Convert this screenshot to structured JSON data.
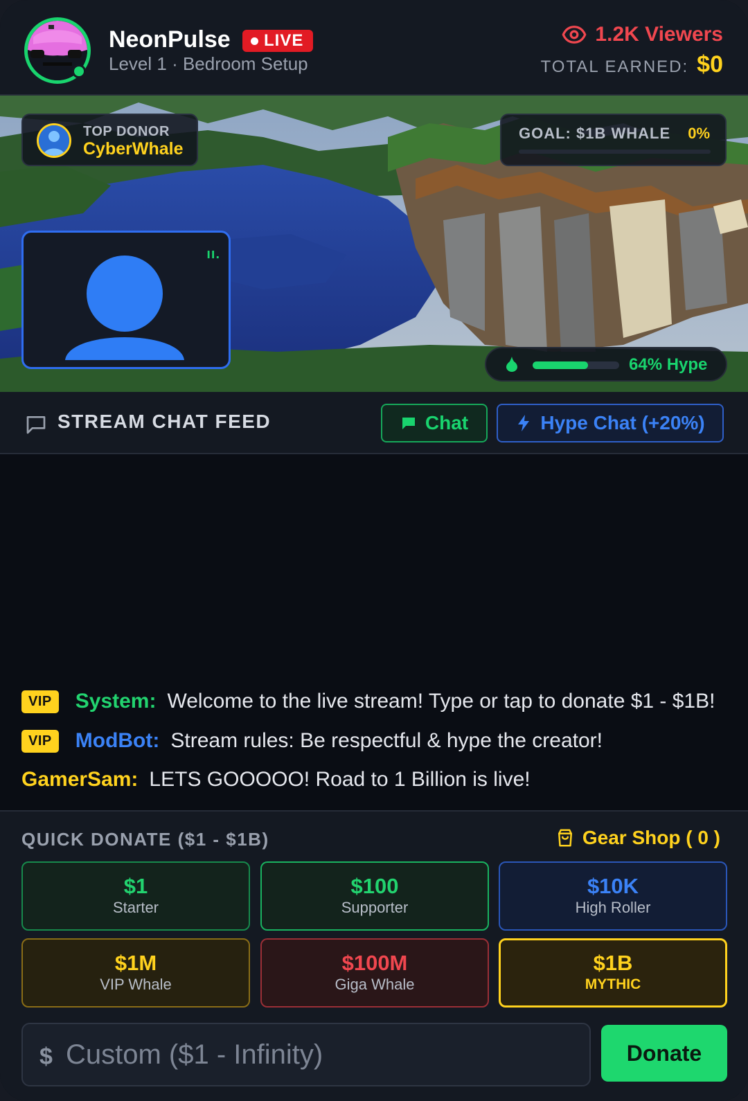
{
  "header": {
    "streamer_name": "NeonPulse",
    "live_label": "LIVE",
    "subline": "Level 1 · Bedroom Setup",
    "viewers": "1.2K Viewers",
    "earned_label": "TOTAL EARNED:",
    "earned_value": "$0"
  },
  "stream": {
    "top_donor_label": "TOP DONOR",
    "top_donor_name": "CyberWhale",
    "goal_label": "GOAL: $1B WHALE",
    "goal_percent": "0%",
    "goal_progress": 0,
    "cam_indicator": "ıı.",
    "hype_text": "64% Hype",
    "hype_progress": 0.64
  },
  "chat": {
    "title": "STREAM CHAT FEED",
    "chat_button": "Chat",
    "hype_button": "Hype Chat (+20%)",
    "messages": [
      {
        "badge": "VIP",
        "user": "System:",
        "text": "Welcome to the live stream! Type or tap to donate $1 - $1B!",
        "color": "#22d36f"
      },
      {
        "badge": "VIP",
        "user": "ModBot:",
        "text": "Stream rules: Be respectful & hype the creator!",
        "color": "#3b82f6"
      },
      {
        "badge": "",
        "user": "GamerSam:",
        "text": "LETS GOOOOO! Road to 1 Billion is live!",
        "color": "#ffd21e"
      }
    ]
  },
  "donate": {
    "title": "QUICK DONATE ($1 - $1B)",
    "gear_shop": "Gear Shop ( 0 )",
    "tiers": [
      {
        "amount": "$1",
        "label": "Starter",
        "color": "#22d36f"
      },
      {
        "amount": "$100",
        "label": "Supporter",
        "color": "#22d36f"
      },
      {
        "amount": "$10K",
        "label": "High Roller",
        "color": "#3b82f6"
      },
      {
        "amount": "$1M",
        "label": "VIP Whale",
        "color": "#ffd21e"
      },
      {
        "amount": "$100M",
        "label": "Giga Whale",
        "color": "#f0474f"
      },
      {
        "amount": "$1B",
        "label": "MYTHIC",
        "color": "#ffd21e"
      }
    ],
    "currency_symbol": "$",
    "custom_placeholder": "Custom ($1 - Infinity)",
    "custom_value": "",
    "donate_button": "Donate"
  },
  "colors": {
    "accent_green": "#19d46e",
    "accent_yellow": "#ffd21e",
    "accent_red": "#e21b24",
    "accent_blue": "#3b82f6"
  }
}
